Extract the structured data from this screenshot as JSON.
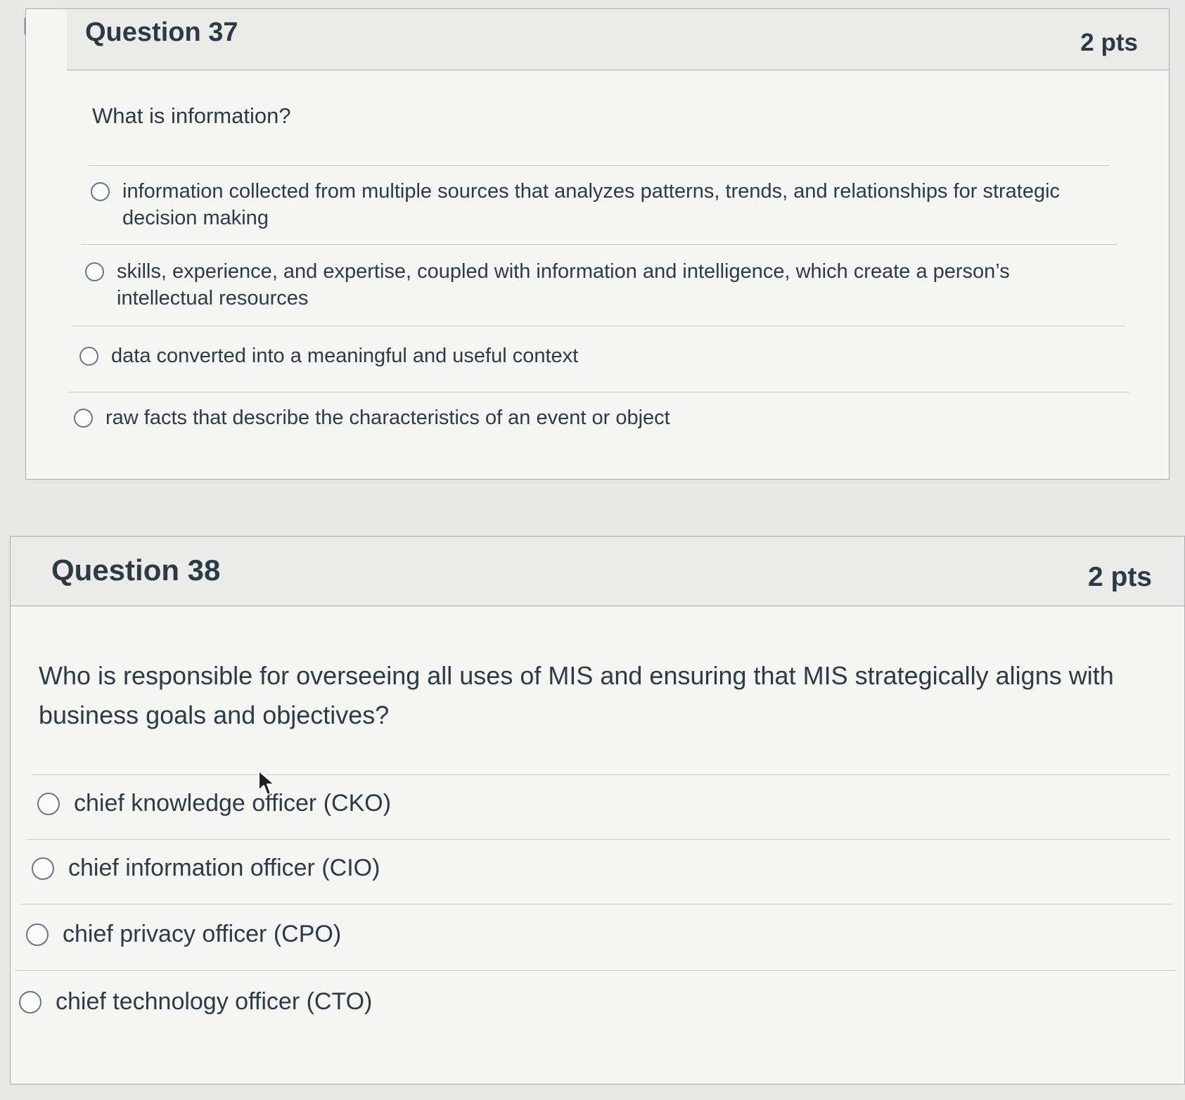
{
  "questions": [
    {
      "title": "Question 37",
      "points": "2 pts",
      "text": "What is information?",
      "answers": [
        "information collected from multiple sources that analyzes patterns, trends, and relationships for strategic decision making",
        "skills, experience, and expertise, coupled with information and intelligence, which create a person’s intellectual resources",
        "data converted into a meaningful and useful context",
        "raw facts that describe the characteristics of an event or object"
      ]
    },
    {
      "title": "Question 38",
      "points": "2 pts",
      "text": "Who is responsible for overseeing all uses of MIS and ensuring that MIS strategically aligns with business goals and objectives?",
      "answers": [
        "chief knowledge officer (CKO)",
        "chief information officer (CIO)",
        "chief privacy officer (CPO)",
        "chief technology officer (CTO)"
      ]
    }
  ],
  "icons": {
    "flag": "flag-question-icon",
    "cursor": "mouse-pointer-icon"
  }
}
